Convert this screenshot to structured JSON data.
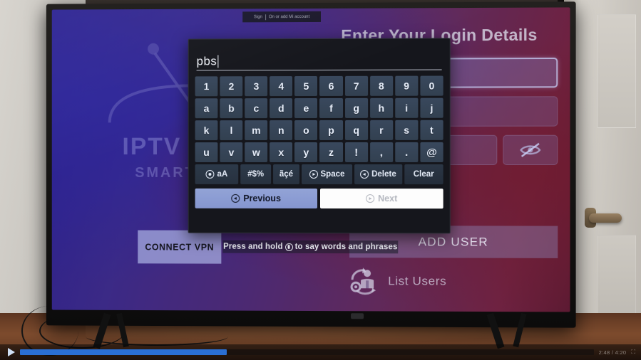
{
  "scene": {
    "description": "photo of a television displaying an IPTV Smarters login screen with an on-screen keyboard"
  },
  "tv_topbar": {
    "left_label": "Sign",
    "right_label": "On or add Mi account"
  },
  "app": {
    "title": "Enter Your Login Details",
    "logo": {
      "word": "IPTV",
      "tagline": "SMART"
    },
    "fields": [
      {
        "name": "any-name",
        "value": "",
        "focused": true
      },
      {
        "name": "username",
        "value": "",
        "focused": false
      },
      {
        "name": "password",
        "value": "",
        "focused": false
      }
    ],
    "password_toggle_icon": "eye-slash-icon",
    "buttons": {
      "connect_vpn": "CONNECT VPN",
      "add_user": "ADD USER"
    },
    "list_users": {
      "label": "List Users",
      "icon": "list-users-icon"
    }
  },
  "keyboard": {
    "input": {
      "value": "pbs",
      "caret": true
    },
    "rows": [
      [
        "1",
        "2",
        "3",
        "4",
        "5",
        "6",
        "7",
        "8",
        "9",
        "0"
      ],
      [
        "a",
        "b",
        "c",
        "d",
        "e",
        "f",
        "g",
        "h",
        "i",
        "j"
      ],
      [
        "k",
        "l",
        "m",
        "n",
        "o",
        "p",
        "q",
        "r",
        "s",
        "t"
      ],
      [
        "u",
        "v",
        "w",
        "x",
        "y",
        "z",
        "!",
        ",",
        ".",
        "@"
      ]
    ],
    "function_keys": [
      {
        "id": "case-toggle",
        "label": "aA",
        "icon": "dot-circle-icon"
      },
      {
        "id": "symbols",
        "label": "#$%",
        "icon": ""
      },
      {
        "id": "accents",
        "label": "ãçé",
        "icon": ""
      },
      {
        "id": "space",
        "label": "Space",
        "icon": "circle-right-icon"
      },
      {
        "id": "delete",
        "label": "Delete",
        "icon": "circle-left-icon"
      },
      {
        "id": "clear",
        "label": "Clear",
        "icon": ""
      }
    ],
    "nav": [
      {
        "id": "previous",
        "label": "Previous",
        "icon": "circle-left-icon",
        "focused": false
      },
      {
        "id": "next",
        "label": "Next",
        "icon": "circle-right-icon",
        "focused": true
      }
    ],
    "voice_hint": {
      "before": "Press and hold",
      "after": "to say words and phrases",
      "icon": "mic-circle-icon"
    }
  },
  "player": {
    "play_icon": "play-icon",
    "progress_percent": 36,
    "time_label": "2:48 / 4:20",
    "fullscreen_icon": "fullscreen-icon"
  },
  "colors": {
    "screen_blue": "#2a1f86",
    "screen_magenta": "#6b2340",
    "key_face": "#3a485c",
    "key_text": "#e9f0fb",
    "prev_button": "#8696cc",
    "next_button": "#fdfdfd",
    "progress": "#2a6fd4"
  }
}
